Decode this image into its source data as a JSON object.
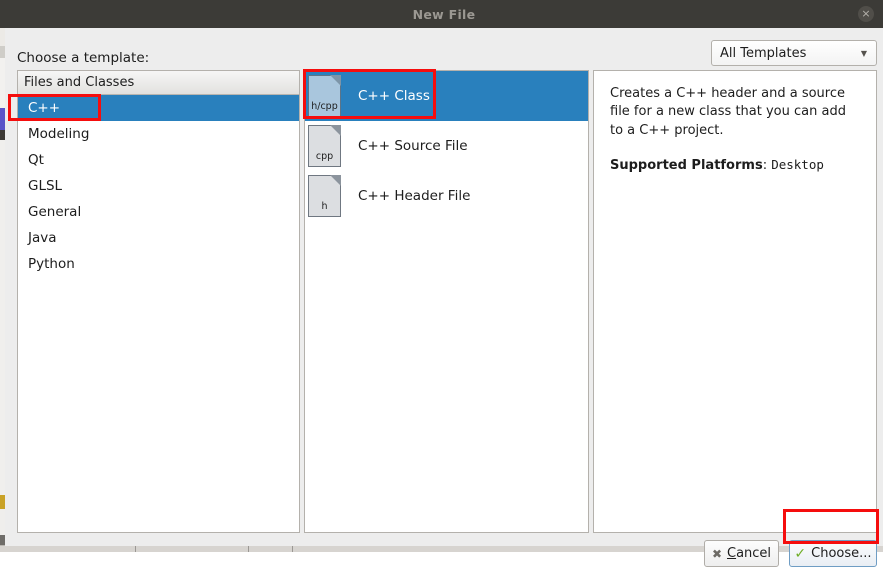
{
  "window": {
    "title": "New File",
    "close_icon": "close-icon",
    "close_glyph": "×"
  },
  "toolbar": {
    "choose_template_label": "Choose a template:",
    "filter": {
      "selected": "All Templates",
      "arrow_icon": "chevron-down-icon",
      "arrow_glyph": "▼"
    }
  },
  "categories": {
    "header": "Files and Classes",
    "items": [
      {
        "label": "C++",
        "selected": true
      },
      {
        "label": "Modeling",
        "selected": false
      },
      {
        "label": "Qt",
        "selected": false
      },
      {
        "label": "GLSL",
        "selected": false
      },
      {
        "label": "General",
        "selected": false
      },
      {
        "label": "Java",
        "selected": false
      },
      {
        "label": "Python",
        "selected": false
      }
    ]
  },
  "templates": {
    "items": [
      {
        "label": "C++ Class",
        "icon_ext": "h/cpp",
        "icon_name": "file-hcpp-icon",
        "selected": true
      },
      {
        "label": "C++ Source File",
        "icon_ext": "cpp",
        "icon_name": "file-cpp-icon",
        "selected": false
      },
      {
        "label": "C++ Header File",
        "icon_ext": "h",
        "icon_name": "file-h-icon",
        "selected": false
      }
    ]
  },
  "description": {
    "text": "Creates a C++ header and a source file for a new class that you can add to a C++ project.",
    "supported_label": "Supported Platforms",
    "supported_separator": ": ",
    "supported_value": "Desktop"
  },
  "buttons": {
    "cancel": {
      "label": "Cancel",
      "accel_letter": "C",
      "rest": "ancel",
      "icon_name": "cross-icon",
      "icon_glyph": "✖"
    },
    "choose": {
      "label": "Choose...",
      "icon_name": "checkmark-icon",
      "icon_glyph": "✓"
    }
  },
  "annotations": {
    "highlight_color": "#f50d0d",
    "boxes": [
      {
        "name": "cpp-category-highlight"
      },
      {
        "name": "cpp-class-template-highlight"
      },
      {
        "name": "choose-button-highlight"
      }
    ]
  },
  "colors": {
    "titlebar_bg": "#3c3b37",
    "selection_blue": "#2980bd",
    "dialog_bg": "#ededed",
    "panel_bg": "#ffffff"
  }
}
